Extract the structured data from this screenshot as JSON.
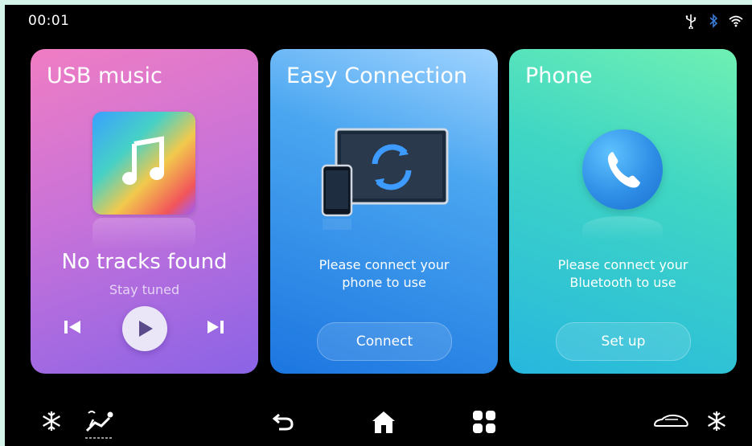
{
  "status_bar": {
    "time": "00:01",
    "icons": [
      "usb-icon",
      "bluetooth-icon",
      "wifi-icon"
    ]
  },
  "cards": {
    "usb": {
      "title": "USB music",
      "track_title": "No tracks found",
      "track_subtitle": "Stay tuned",
      "controls": [
        "previous-icon",
        "play-icon",
        "next-icon"
      ]
    },
    "easy": {
      "title": "Easy Connection",
      "message_line1": "Please connect your",
      "message_line2": "phone to use",
      "button_label": "Connect"
    },
    "phone": {
      "title": "Phone",
      "message_line1": "Please connect your",
      "message_line2": "Bluetooth to use",
      "button_label": "Set up"
    }
  },
  "dock": {
    "icons": [
      "snowflake-icon",
      "seat-airflow-icon",
      "back-icon",
      "home-icon",
      "apps-icon",
      "car-icon",
      "snowflake-icon"
    ]
  },
  "colors": {
    "usb_gradient": [
      "#f07dc3",
      "#8a63e6"
    ],
    "easy_gradient": [
      "#9fd3ff",
      "#1c76e0"
    ],
    "phone_gradient": [
      "#6ff0b3",
      "#27b7de"
    ]
  }
}
